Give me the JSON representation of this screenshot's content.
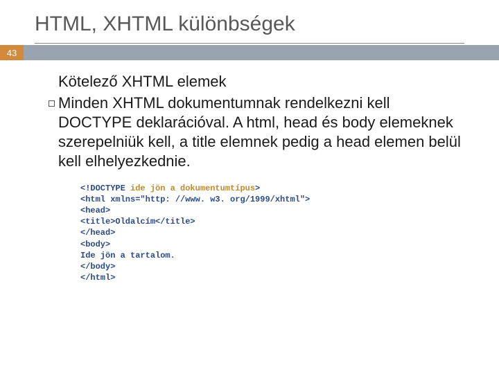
{
  "slide": {
    "title": "HTML, XHTML különbségek",
    "pageNumber": "43",
    "subheading": "Kötelező XHTML elemek",
    "bulletText": "Minden XHTML dokumentumnak rendelkezni kell DOCTYPE deklarációval. A html, head és body elemeknek szerepelniük kell, a title elemnek pedig a head elemen belül kell elhelyezkednie.",
    "code": {
      "line1_prefix": "<!DOCTYPE ",
      "line1_highlight": "ide jön a dokumentumtípus",
      "line1_suffix": ">",
      "line2": "<html xmlns=\"http: //www. w3. org/1999/xhtml\">",
      "line3": "<head>",
      "line4": "<title>Oldalcím</title>",
      "line5": "</head>",
      "line6": "<body>",
      "line7": "Ide jön a tartalom.",
      "line8": "</body>",
      "line9": "</html>"
    }
  }
}
